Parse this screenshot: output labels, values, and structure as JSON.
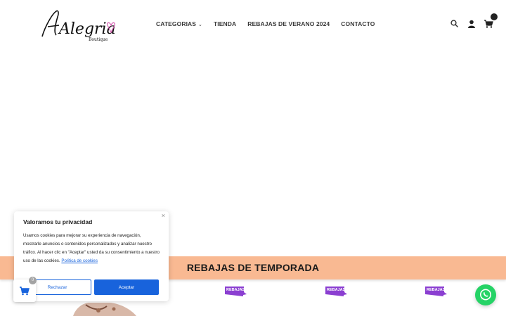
{
  "header": {
    "logo_text": "Alegria",
    "logo_subtext": "Boutique",
    "nav": [
      {
        "label": "CATEGORIAS",
        "has_dropdown": true
      },
      {
        "label": "TIENDA"
      },
      {
        "label": "REBAJAS DE VERANO 2024"
      },
      {
        "label": "CONTACTO"
      }
    ],
    "icons": [
      "search-icon",
      "account-icon",
      "cart-icon"
    ]
  },
  "banner": {
    "title": "REBAJAS DE TEMPORADA",
    "color": "#f9b992"
  },
  "sale_tags": [
    "REBAJAS",
    "REBAJAS",
    "REBAJAS"
  ],
  "cookie": {
    "title": "Valoramos tu privacidad",
    "text": "Usamos cookies para mejorar su experiencia de navegación, mostrarle anuncios o contenidos personalizados y analizar nuestro tráfico. Al hacer clic en \"Aceptar\" usted da su consentimiento a nuestro uso de las cookies.",
    "link": "Política de cookies",
    "reject_label": "Rechazar",
    "accept_label": "Aceptar",
    "close_label": "×",
    "accent": "#1863dc"
  },
  "floating_cart": {
    "count": "0"
  },
  "whatsapp": {
    "color": "#25d366"
  }
}
